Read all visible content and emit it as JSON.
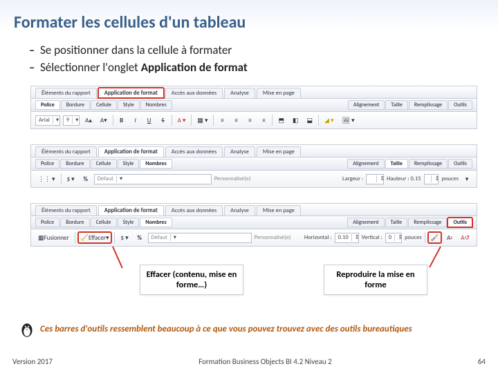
{
  "title": "Formater les cellules d'un tableau",
  "bullets": [
    "Se positionner dans la cellule à formater",
    "Sélectionner l'onglet <b>Application de format</b>"
  ],
  "tabs": {
    "main": [
      "Éléments du rapport",
      "Application de format",
      "Accès aux données",
      "Analyse",
      "Mise en page"
    ],
    "activeMain": "Application de format",
    "sub_right": [
      "Alignement",
      "Taille",
      "Remplissage",
      "Outils"
    ]
  },
  "ribbon1": {
    "sub_left": [
      "Police",
      "Bordure",
      "Cellule",
      "Style",
      "Nombres"
    ],
    "active": "Police",
    "font": "Arial",
    "size": "9"
  },
  "ribbon2": {
    "sub_left": [
      "Police",
      "Bordure",
      "Cellule",
      "Style",
      "Nombres"
    ],
    "active": "Nombres",
    "format_label": "Défaut",
    "pers": "Personnalisé(e)",
    "largeur": "Largeur :",
    "hauteur": "Hauteur :  0.15",
    "unit": "pouces"
  },
  "ribbon3": {
    "sub_left": [
      "Police",
      "Bordure",
      "Cellule",
      "Style",
      "Nombres"
    ],
    "active": "Nombres",
    "merge": "Fusionner",
    "clear": "Effacer",
    "format_label": "Défaut",
    "pers": "Personnalisé(e)",
    "h": "Horizontal :",
    "v": "Vertical :",
    "hval": "0.10",
    "vval": "0",
    "unit": "pouces"
  },
  "callouts": {
    "left": "Effacer (contenu, mise en forme…)",
    "right": "Reproduire la mise en forme"
  },
  "note": "Ces barres d'outils ressemblent beaucoup à ce que vous pouvez trouvez avec des outils bureautiques",
  "footer": {
    "left": "Version 2017",
    "center": "Formation Business Objects BI 4.2 Niveau 2",
    "right": "64"
  }
}
